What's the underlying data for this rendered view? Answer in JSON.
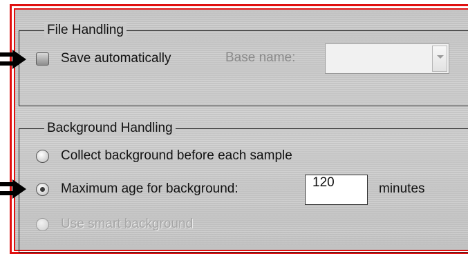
{
  "file_handling": {
    "title": "File Handling",
    "save_automatically": {
      "label": "Save automatically",
      "checked": false
    },
    "base_name": {
      "label": "Base name:",
      "value": "",
      "enabled": false
    }
  },
  "background_handling": {
    "title": "Background Handling",
    "options": [
      {
        "label": "Collect background before each sample",
        "selected": false,
        "enabled": true
      },
      {
        "label": "Maximum age for background:",
        "selected": true,
        "enabled": true
      },
      {
        "label": "Use smart background",
        "selected": false,
        "enabled": false
      }
    ],
    "max_age_value": "120",
    "max_age_unit": "minutes"
  },
  "colors": {
    "highlight_border": "#e01010",
    "panel_bg": "#c9c9c9"
  },
  "icons": [
    "callout-arrow-icon",
    "callout-arrow-icon"
  ]
}
